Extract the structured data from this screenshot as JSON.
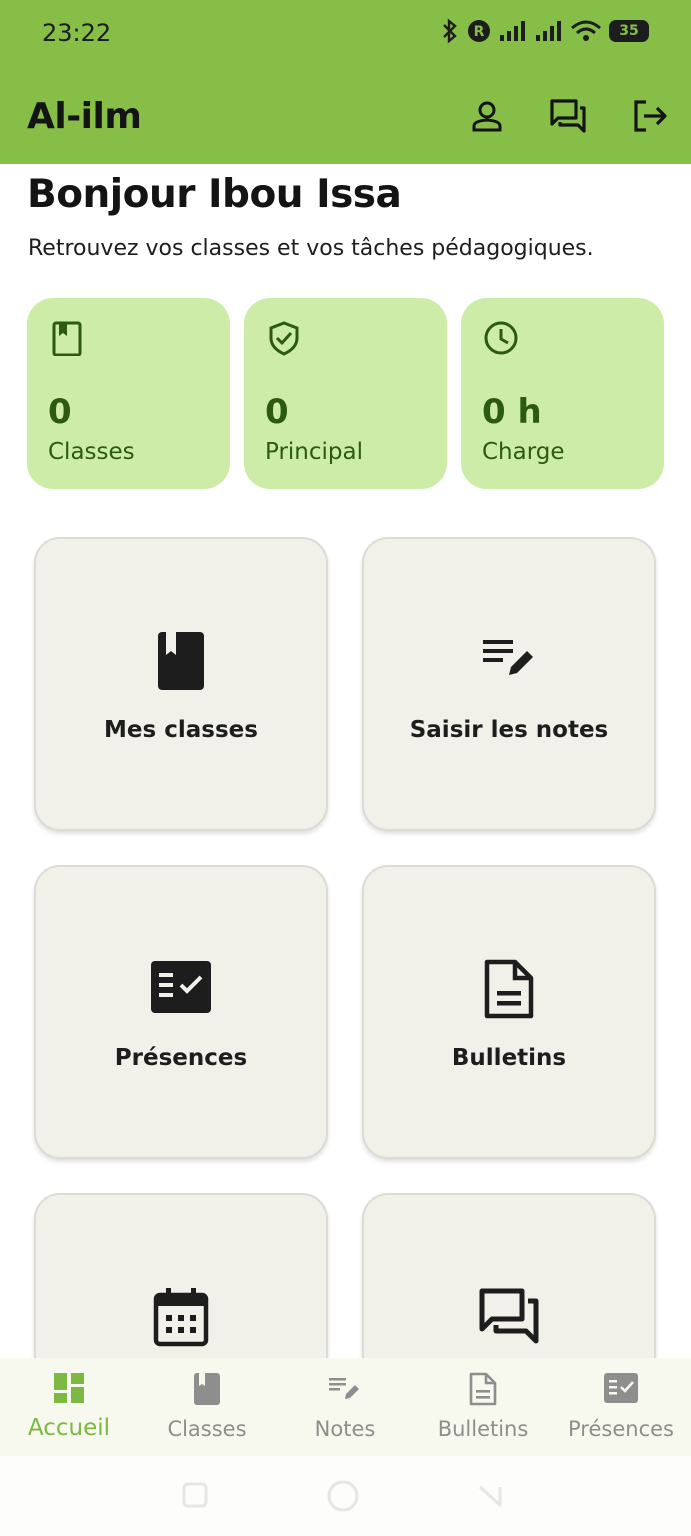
{
  "status": {
    "time": "23:22",
    "battery": "35"
  },
  "appbar": {
    "title": "Al-ilm"
  },
  "greeting": {
    "title": "Bonjour Ibou Issa",
    "subtitle": "Retrouvez vos classes et vos tâches pédagogiques."
  },
  "stats": [
    {
      "value": "0",
      "label": "Classes",
      "icon": "bookmark-book-icon"
    },
    {
      "value": "0",
      "label": "Principal",
      "icon": "shield-check-icon"
    },
    {
      "value": "0 h",
      "label": "Charge",
      "icon": "clock-icon"
    }
  ],
  "tiles": [
    {
      "label": "Mes classes",
      "icon": "book-icon"
    },
    {
      "label": "Saisir les notes",
      "icon": "edit-notes-icon"
    },
    {
      "label": "Présences",
      "icon": "fact-check-icon"
    },
    {
      "label": "Bulletins",
      "icon": "document-icon"
    },
    {
      "label": "",
      "icon": "calendar-icon"
    },
    {
      "label": "",
      "icon": "forum-icon"
    }
  ],
  "nav": [
    {
      "label": "Accueil",
      "icon": "dashboard-icon",
      "active": true
    },
    {
      "label": "Classes",
      "icon": "book-icon"
    },
    {
      "label": "Notes",
      "icon": "edit-notes-icon"
    },
    {
      "label": "Bulletins",
      "icon": "document-icon"
    },
    {
      "label": "Présences",
      "icon": "fact-check-icon"
    }
  ],
  "colors": {
    "brand": "#86be47",
    "stat_bg": "#cdeca8",
    "stat_text": "#2c5a10",
    "tile_bg": "#f1f1ea",
    "nav_active": "#7cb842",
    "nav_inactive": "#8e8e8e"
  }
}
